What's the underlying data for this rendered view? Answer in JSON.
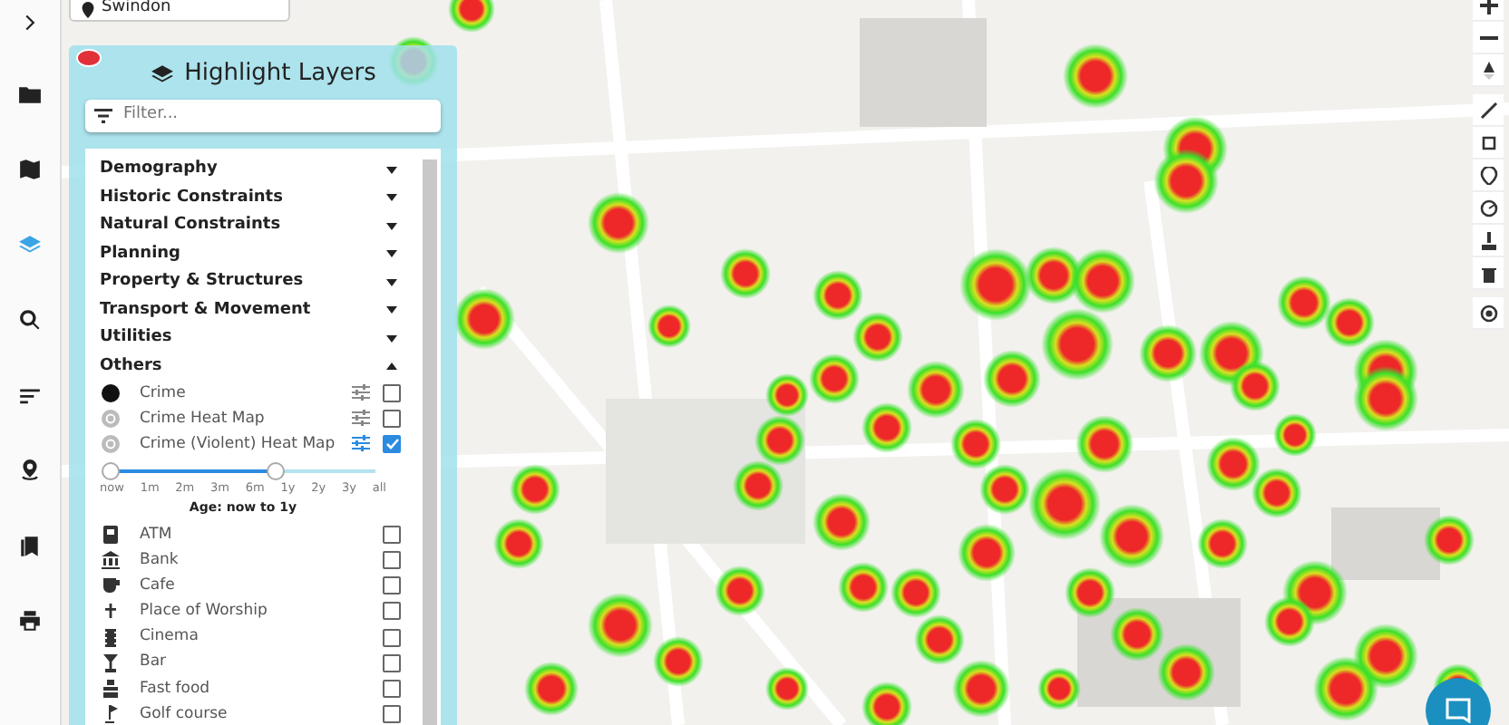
{
  "sidebar": {
    "items": [
      {
        "selected": false
      },
      {
        "selected": false
      },
      {
        "selected": true
      },
      {
        "selected": false
      },
      {
        "selected": false
      },
      {
        "selected": false
      },
      {
        "selected": false
      },
      {
        "selected": false
      }
    ]
  },
  "search": {
    "value": "Swindon"
  },
  "panel": {
    "title": "Highlight Layers",
    "filter": {
      "placeholder": "Filter..."
    },
    "groups": [
      {
        "label": "Demography",
        "expanded": false
      },
      {
        "label": "Historic Constraints",
        "expanded": false
      },
      {
        "label": "Natural Constraints",
        "expanded": false
      },
      {
        "label": "Planning",
        "expanded": false
      },
      {
        "label": "Property & Structures",
        "expanded": false
      },
      {
        "label": "Transport & Movement",
        "expanded": false
      },
      {
        "label": "Utilities",
        "expanded": false
      },
      {
        "label": "Others",
        "expanded": true,
        "layers": [
          {
            "kind": "layer",
            "label": "Crime",
            "settings": true,
            "checked": false
          },
          {
            "kind": "layer",
            "label": "Crime Heat Map",
            "settings": true,
            "checked": false
          },
          {
            "kind": "layer",
            "label": "Crime (Violent) Heat Map",
            "settings": true,
            "checked": true
          },
          {
            "kind": "range",
            "ticks": [
              "now",
              "1m",
              "2m",
              "3m",
              "6m",
              "1y",
              "2y",
              "3y",
              "all"
            ],
            "level": 0.625,
            "caption": "Age: now to 1y"
          },
          {
            "kind": "layer",
            "label": "ATM",
            "checked": false
          },
          {
            "kind": "layer",
            "label": "Bank",
            "checked": false
          },
          {
            "kind": "layer",
            "label": "Cafe",
            "checked": false
          },
          {
            "kind": "layer",
            "label": "Place of Worship",
            "checked": false
          },
          {
            "kind": "layer",
            "label": "Cinema",
            "checked": false
          },
          {
            "kind": "layer",
            "label": "Bar",
            "checked": false
          },
          {
            "kind": "layer",
            "label": "Fast food",
            "checked": false
          },
          {
            "kind": "layer",
            "label": "Golf course",
            "checked": false
          }
        ]
      }
    ]
  }
}
